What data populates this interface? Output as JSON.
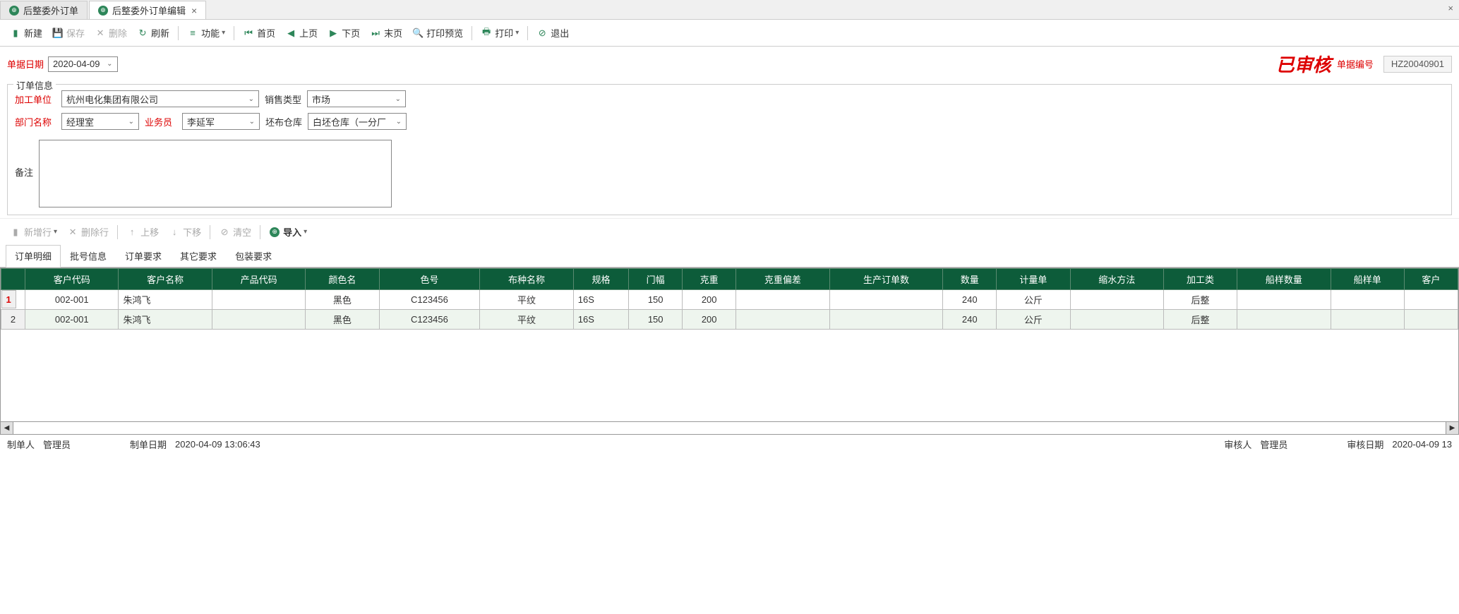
{
  "tabs": {
    "items": [
      {
        "label": "后整委外订单",
        "active": false
      },
      {
        "label": "后整委外订单编辑",
        "active": true
      }
    ]
  },
  "toolbar": {
    "new": "新建",
    "save": "保存",
    "delete": "删除",
    "refresh": "刷新",
    "functions": "功能",
    "first": "首页",
    "prev": "上页",
    "next": "下页",
    "last": "末页",
    "preview": "打印预览",
    "print": "打印",
    "exit": "退出"
  },
  "doc": {
    "date_label": "单据日期",
    "date_value": "2020-04-09",
    "stamp": "已审核",
    "no_label": "单据编号",
    "no_value": "HZ20040901"
  },
  "order": {
    "legend": "订单信息",
    "jiagong_label": "加工单位",
    "jiagong_value": "杭州电化集团有限公司",
    "saletype_label": "销售类型",
    "saletype_value": "市场",
    "dept_label": "部门名称",
    "dept_value": "经理室",
    "sales_label": "业务员",
    "sales_value": "李延军",
    "warehouse_label": "坯布仓库",
    "warehouse_value": "白坯仓库（一分厂",
    "remark_label": "备注"
  },
  "sub_toolbar": {
    "addrow": "新增行",
    "delrow": "删除行",
    "moveup": "上移",
    "movedown": "下移",
    "clear": "清空",
    "import": "导入"
  },
  "sub_tabs": {
    "items": [
      "订单明细",
      "批号信息",
      "订单要求",
      "其它要求",
      "包装要求"
    ]
  },
  "grid": {
    "headers": [
      "",
      "客户代码",
      "客户名称",
      "产品代码",
      "颜色名",
      "色号",
      "布种名称",
      "规格",
      "门幅",
      "克重",
      "克重偏差",
      "生产订单数",
      "数量",
      "计量单",
      "缩水方法",
      "加工类",
      "船样数量",
      "船样单",
      "客户"
    ],
    "rows": [
      {
        "n": "1",
        "cust_code": "002-001",
        "cust_name": "朱鸿飞",
        "prod_code": "",
        "color": "黑色",
        "color_no": "C123456",
        "fabric": "平纹",
        "spec": "16S",
        "width": "150",
        "weight": "200",
        "tol": "",
        "prod_qty": "",
        "qty": "240",
        "unit": "公斤",
        "shrink": "",
        "proc": "后整",
        "ship_qty": "",
        "ship_no": ""
      },
      {
        "n": "2",
        "cust_code": "002-001",
        "cust_name": "朱鸿飞",
        "prod_code": "",
        "color": "黑色",
        "color_no": "C123456",
        "fabric": "平纹",
        "spec": "16S",
        "width": "150",
        "weight": "200",
        "tol": "",
        "prod_qty": "",
        "qty": "240",
        "unit": "公斤",
        "shrink": "",
        "proc": "后整",
        "ship_qty": "",
        "ship_no": ""
      }
    ]
  },
  "status": {
    "maker_label": "制单人",
    "maker": "管理员",
    "make_date_label": "制单日期",
    "make_date": "2020-04-09 13:06:43",
    "auditor_label": "审核人",
    "auditor": "管理员",
    "audit_date_label": "审核日期",
    "audit_date": "2020-04-09 13"
  }
}
